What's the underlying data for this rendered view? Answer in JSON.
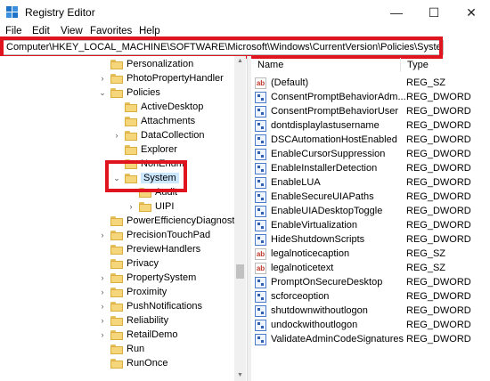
{
  "window": {
    "title": "Registry Editor",
    "minimize": "—",
    "maximize": "☐",
    "close": "✕"
  },
  "menu": [
    "File",
    "Edit",
    "View",
    "Favorites",
    "Help"
  ],
  "address": "Computer\\HKEY_LOCAL_MACHINE\\SOFTWARE\\Microsoft\\Windows\\CurrentVersion\\Policies\\System",
  "tree": [
    {
      "label": "Personalization",
      "level": 1,
      "exp": ""
    },
    {
      "label": "PhotoPropertyHandler",
      "level": 1,
      "exp": "›"
    },
    {
      "label": "Policies",
      "level": 1,
      "exp": "⌄"
    },
    {
      "label": "ActiveDesktop",
      "level": 2,
      "exp": ""
    },
    {
      "label": "Attachments",
      "level": 2,
      "exp": ""
    },
    {
      "label": "DataCollection",
      "level": 2,
      "exp": "›"
    },
    {
      "label": "Explorer",
      "level": 2,
      "exp": ""
    },
    {
      "label": "NonEnum",
      "level": 2,
      "exp": ""
    },
    {
      "label": "System",
      "level": 2,
      "exp": "⌄",
      "selected": true
    },
    {
      "label": "Audit",
      "level": 3,
      "exp": ""
    },
    {
      "label": "UIPI",
      "level": 3,
      "exp": "›"
    },
    {
      "label": "PowerEfficiencyDiagnosti",
      "level": 1,
      "exp": ""
    },
    {
      "label": "PrecisionTouchPad",
      "level": 1,
      "exp": "›"
    },
    {
      "label": "PreviewHandlers",
      "level": 1,
      "exp": ""
    },
    {
      "label": "Privacy",
      "level": 1,
      "exp": ""
    },
    {
      "label": "PropertySystem",
      "level": 1,
      "exp": "›"
    },
    {
      "label": "Proximity",
      "level": 1,
      "exp": "›"
    },
    {
      "label": "PushNotifications",
      "level": 1,
      "exp": "›"
    },
    {
      "label": "Reliability",
      "level": 1,
      "exp": "›"
    },
    {
      "label": "RetailDemo",
      "level": 1,
      "exp": "›"
    },
    {
      "label": "Run",
      "level": 1,
      "exp": ""
    },
    {
      "label": "RunOnce",
      "level": 1,
      "exp": ""
    }
  ],
  "columns": {
    "name": "Name",
    "type": "Type"
  },
  "values": [
    {
      "name": "(Default)",
      "type": "REG_SZ",
      "icon": "string-value-icon"
    },
    {
      "name": "ConsentPromptBehaviorAdm...",
      "type": "REG_DWORD",
      "icon": "binary-value-icon"
    },
    {
      "name": "ConsentPromptBehaviorUser",
      "type": "REG_DWORD",
      "icon": "binary-value-icon"
    },
    {
      "name": "dontdisplaylastusername",
      "type": "REG_DWORD",
      "icon": "binary-value-icon"
    },
    {
      "name": "DSCAutomationHostEnabled",
      "type": "REG_DWORD",
      "icon": "binary-value-icon"
    },
    {
      "name": "EnableCursorSuppression",
      "type": "REG_DWORD",
      "icon": "binary-value-icon"
    },
    {
      "name": "EnableInstallerDetection",
      "type": "REG_DWORD",
      "icon": "binary-value-icon"
    },
    {
      "name": "EnableLUA",
      "type": "REG_DWORD",
      "icon": "binary-value-icon"
    },
    {
      "name": "EnableSecureUIAPaths",
      "type": "REG_DWORD",
      "icon": "binary-value-icon"
    },
    {
      "name": "EnableUIADesktopToggle",
      "type": "REG_DWORD",
      "icon": "binary-value-icon"
    },
    {
      "name": "EnableVirtualization",
      "type": "REG_DWORD",
      "icon": "binary-value-icon"
    },
    {
      "name": "HideShutdownScripts",
      "type": "REG_DWORD",
      "icon": "binary-value-icon"
    },
    {
      "name": "legalnoticecaption",
      "type": "REG_SZ",
      "icon": "string-value-icon"
    },
    {
      "name": "legalnoticetext",
      "type": "REG_SZ",
      "icon": "string-value-icon"
    },
    {
      "name": "PromptOnSecureDesktop",
      "type": "REG_DWORD",
      "icon": "binary-value-icon"
    },
    {
      "name": "scforceoption",
      "type": "REG_DWORD",
      "icon": "binary-value-icon"
    },
    {
      "name": "shutdownwithoutlogon",
      "type": "REG_DWORD",
      "icon": "binary-value-icon"
    },
    {
      "name": "undockwithoutlogon",
      "type": "REG_DWORD",
      "icon": "binary-value-icon"
    },
    {
      "name": "ValidateAdminCodeSignatures",
      "type": "REG_DWORD",
      "icon": "binary-value-icon"
    }
  ],
  "colors": {
    "highlight": "#e0141e",
    "selection": "#cce8ff",
    "folder": "#f5d67a"
  }
}
